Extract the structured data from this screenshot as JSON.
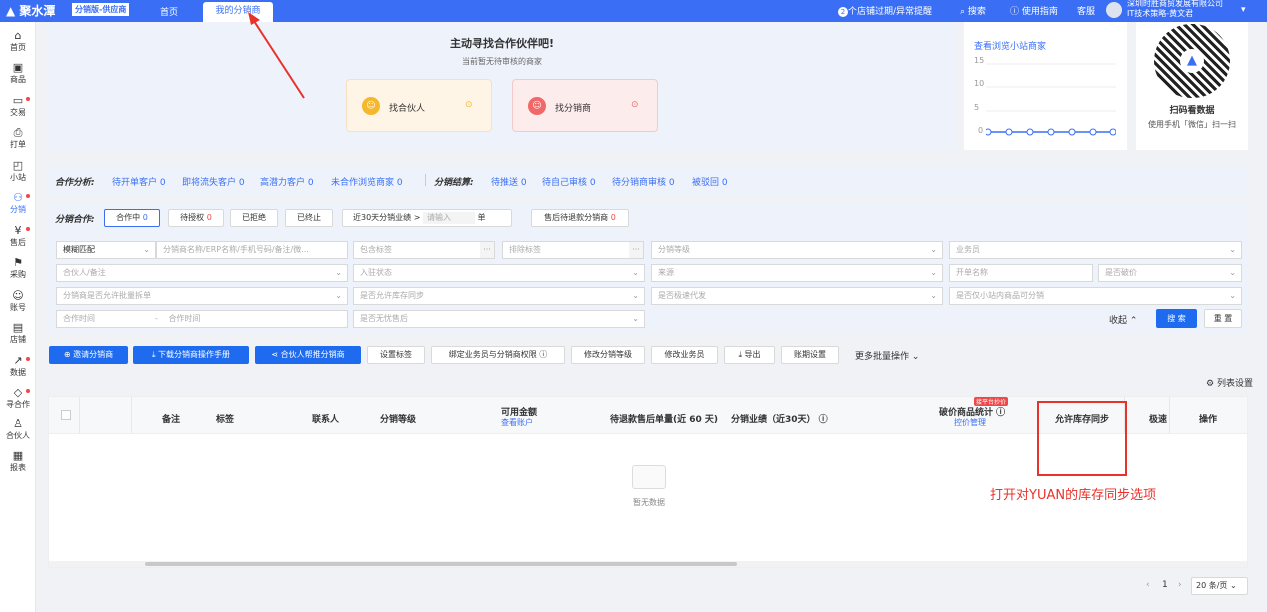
{
  "topbar": {
    "logo": "聚水潭",
    "edition": "分销版-供应商",
    "tab_home": "首页",
    "tab_active": "我的分销商",
    "alert_count": "2",
    "alert_text": "个店铺过期/异常提醒",
    "search": "搜索",
    "guide": "使用指南",
    "service": "客服",
    "company": "深圳时胜商贸发展有限公司",
    "user": "IT技术策略-黄文君"
  },
  "sidebar": {
    "items": [
      {
        "label": "首页",
        "icon": "home-icon"
      },
      {
        "label": "商品",
        "icon": "goods-icon"
      },
      {
        "label": "交易",
        "icon": "trade-icon"
      },
      {
        "label": "打单",
        "icon": "print-icon"
      },
      {
        "label": "小站",
        "icon": "shop-icon"
      },
      {
        "label": "分销",
        "icon": "distribution-icon"
      },
      {
        "label": "售后",
        "icon": "aftersale-icon"
      },
      {
        "label": "采购",
        "icon": "purchase-icon"
      },
      {
        "label": "账号",
        "icon": "account-icon"
      },
      {
        "label": "店铺",
        "icon": "store-icon"
      },
      {
        "label": "数据",
        "icon": "data-icon"
      },
      {
        "label": "寻合作",
        "icon": "partner-icon"
      },
      {
        "label": "合伙人",
        "icon": "user-icon"
      },
      {
        "label": "报表",
        "icon": "report-icon"
      }
    ]
  },
  "banner": {
    "title": "主动寻找合作伙伴吧!",
    "subtitle": "当前暂无待审核的商家",
    "card1": "找合伙人",
    "card2": "找分销商"
  },
  "mini_chart": {
    "link": "查看浏览小站商家",
    "ticks": [
      "15",
      "10",
      "5",
      "0"
    ]
  },
  "qr": {
    "title": "扫码看数据",
    "subtitle": "使用手机「微信」扫一扫"
  },
  "analysis": {
    "label": "合作分析:",
    "items": [
      {
        "name": "待开单客户",
        "count": "0"
      },
      {
        "name": "即将流失客户",
        "count": "0"
      },
      {
        "name": "高潜力客户",
        "count": "0"
      },
      {
        "name": "未合作浏览商家",
        "count": "0"
      }
    ],
    "settle_label": "分销结算:",
    "settle_items": [
      {
        "name": "待推送",
        "count": "0"
      },
      {
        "name": "待自己审核",
        "count": "0"
      },
      {
        "name": "待分销商审核",
        "count": "0"
      },
      {
        "name": "被驳回",
        "count": "0"
      }
    ]
  },
  "coop": {
    "label": "分销合作:",
    "tabs": [
      {
        "name": "合作中",
        "count": "0"
      },
      {
        "name": "待授权",
        "count": "0"
      },
      {
        "name": "已拒绝",
        "count": ""
      },
      {
        "name": "已终止",
        "count": ""
      }
    ],
    "perf_prefix": "近30天分销业绩 >",
    "perf_placeholder": "请输入",
    "perf_unit": "单",
    "pending": "售后待退款分销商",
    "pending_count": "0"
  },
  "filters": {
    "match": "模糊匹配",
    "keyword": "分销商名称/ERP名称/手机号码/备注/微...",
    "include_tag": "包含标签",
    "exclude_tag": "排除标签",
    "level": "分销等级",
    "salesman": "业务员",
    "partner": "合伙人/备注",
    "status": "入驻状态",
    "source": "来源",
    "shop_name": "开单名称",
    "broken_price": "是否破价",
    "batch_split": "分销商是否允许批量拆单",
    "stock_sync": "是否允许库存同步",
    "fast_ship": "是否极速代发",
    "only_site": "是否仅小站内商品可分销",
    "coop_time": "合作时间",
    "coop_time2": "合作时间",
    "no_aftersale": "是否无忧售后",
    "collapse": "收起",
    "search_btn": "搜 索",
    "reset_btn": "重 置"
  },
  "actions": {
    "invite": "邀请分销商",
    "download": "下载分销商操作手册",
    "partner_promote": "合伙人帮推分销商",
    "set_tag": "设置标签",
    "bind_salesman": "绑定业务员与分销商权限",
    "change_level": "修改分销等级",
    "change_salesman": "修改业务员",
    "export": "导出",
    "billing": "账期设置",
    "more": "更多批量操作",
    "col_settings": "列表设置"
  },
  "table": {
    "headers": [
      "备注",
      "标签",
      "联系人",
      "分销等级",
      "可用金额",
      "待退款售后单量(近 60 天)",
      "分销业绩（近30天）",
      "破价商品统计",
      "允许库存同步",
      "极速",
      "操作"
    ],
    "available_link": "查看账户",
    "price_link": "控价管理",
    "price_badge": "接平台抄价",
    "empty": "暂无数据"
  },
  "annotation": {
    "text": "打开对YUAN的库存同步选项",
    "color": "#e8322a"
  },
  "pager": {
    "page": "1",
    "size": "20 条/页"
  }
}
